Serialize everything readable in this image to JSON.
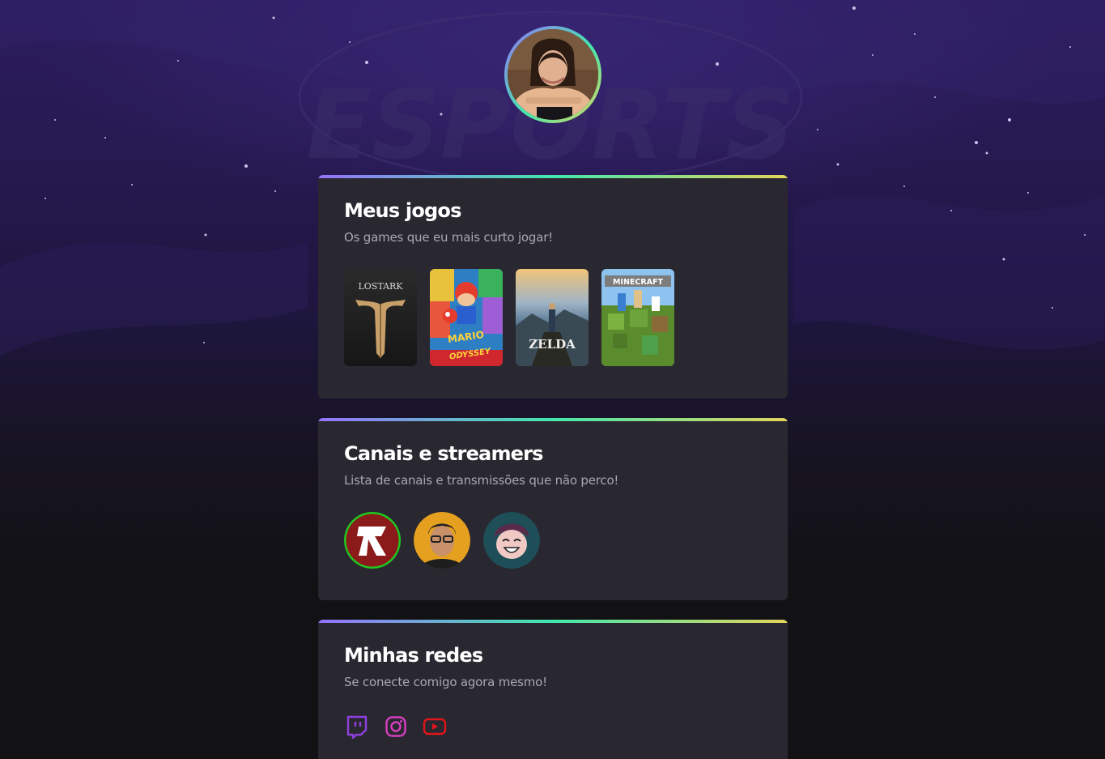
{
  "profile": {
    "avatar_icon": "user-avatar-photo"
  },
  "background": {
    "watermark_text": "ESPORTS"
  },
  "sections": {
    "games": {
      "title": "Meus jogos",
      "subtitle": "Os games que eu mais curto jogar!",
      "items": [
        {
          "name": "Lost Ark",
          "cover_text": "LOSTARK",
          "color": "#1e1e1e"
        },
        {
          "name": "Super Mario Odyssey",
          "cover_text": "ODYSSEY",
          "color": "#d0272e"
        },
        {
          "name": "Zelda Breath of the Wild",
          "cover_text": "ZELDA",
          "color": "#3a5a78"
        },
        {
          "name": "Minecraft",
          "cover_text": "MINECRAFT",
          "color": "#5a8c2e"
        }
      ]
    },
    "channels": {
      "title": "Canais e streamers",
      "subtitle": "Lista de canais e transmissões que não perco!",
      "items": [
        {
          "name": "channel-r",
          "color": "#8b1a1a"
        },
        {
          "name": "channel-man-glasses",
          "color": "#e6a020"
        },
        {
          "name": "channel-cartoon",
          "color": "#2b7080"
        }
      ]
    },
    "socials": {
      "title": "Minhas redes",
      "subtitle": "Se conecte comigo agora mesmo!",
      "items": [
        {
          "name": "twitch-icon",
          "color": "#8e3fe0"
        },
        {
          "name": "instagram-icon",
          "color": "#d53fbf"
        },
        {
          "name": "youtube-icon",
          "color": "#e0161a"
        }
      ]
    }
  }
}
